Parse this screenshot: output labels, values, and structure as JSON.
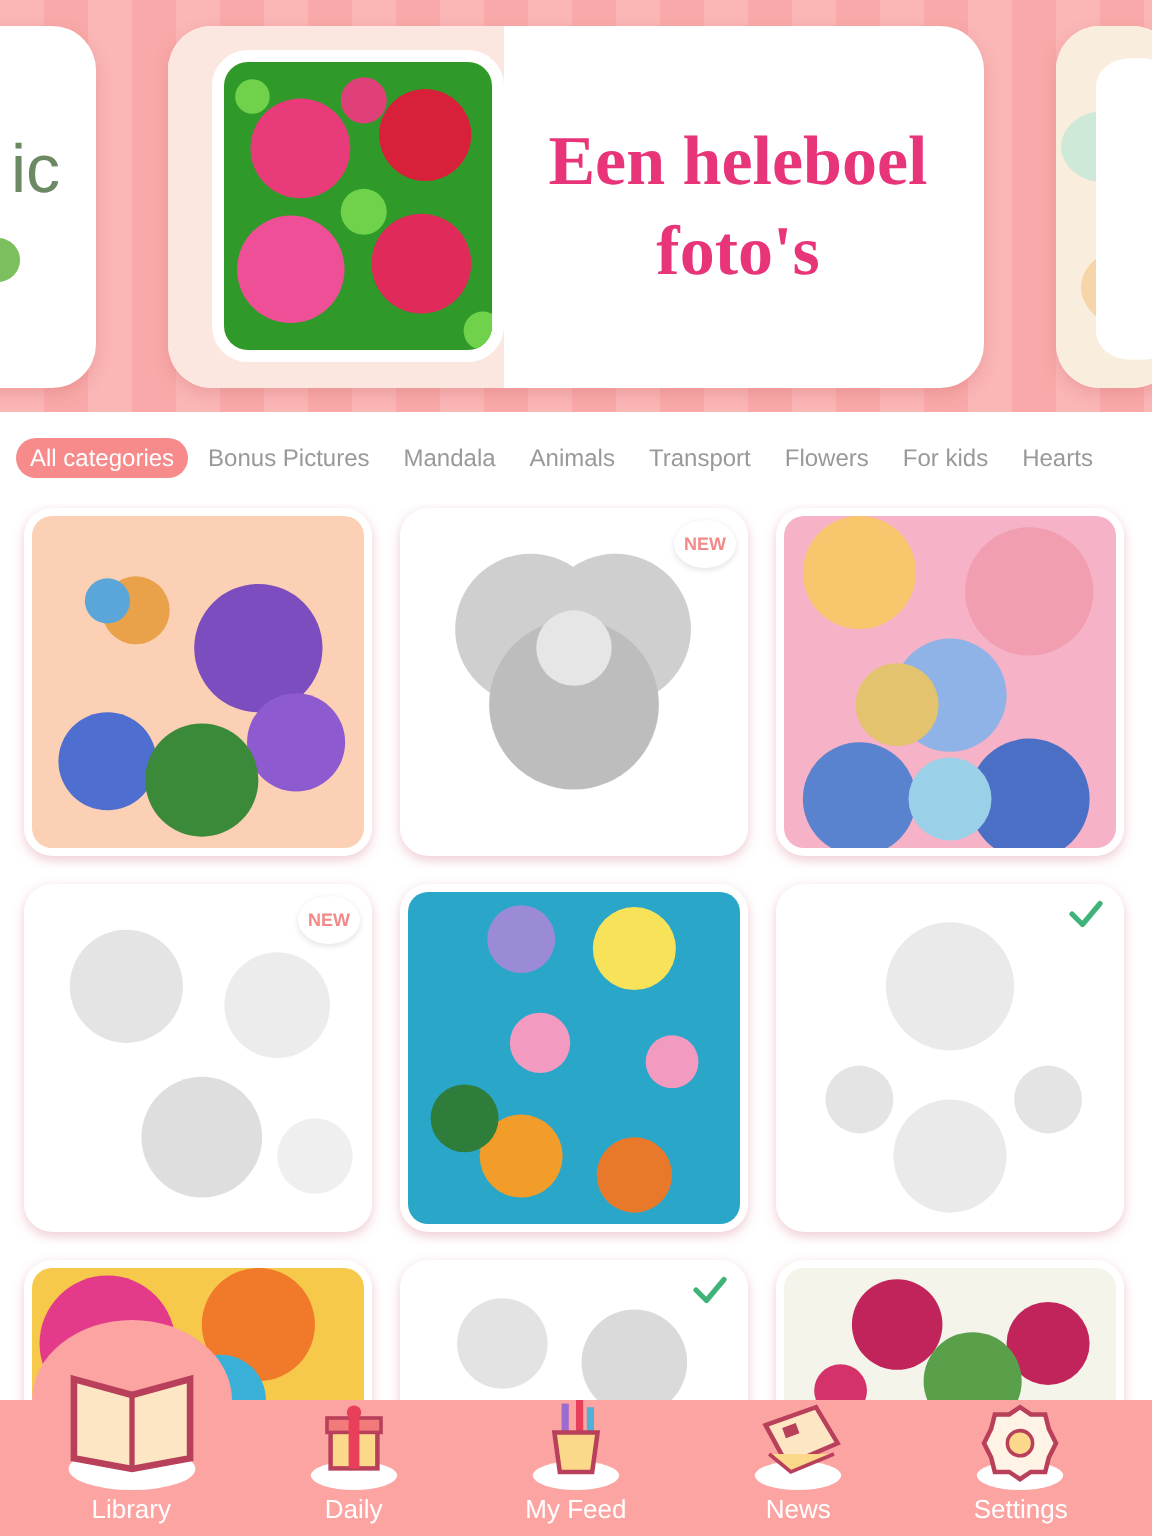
{
  "banner": {
    "left_card": {
      "text": "ic"
    },
    "main_card": {
      "title": "Een heleboel foto's",
      "image": {
        "kind": "picture"
      }
    },
    "right_card": {
      "kind": "picture"
    }
  },
  "categories": [
    {
      "label": "All categories",
      "selected": true
    },
    {
      "label": "Bonus Pictures",
      "selected": false
    },
    {
      "label": "Mandala",
      "selected": false
    },
    {
      "label": "Animals",
      "selected": false
    },
    {
      "label": "Transport",
      "selected": false
    },
    {
      "label": "Flowers",
      "selected": false
    },
    {
      "label": "For kids",
      "selected": false
    },
    {
      "label": "Hearts",
      "selected": false
    }
  ],
  "tiles": [
    {
      "kind": "picture",
      "completed": false
    },
    {
      "kind": "picture",
      "badge": "NEW",
      "completed": false
    },
    {
      "kind": "picture",
      "completed": false
    },
    {
      "kind": "picture",
      "badge": "NEW",
      "completed": false
    },
    {
      "kind": "picture",
      "completed": false
    },
    {
      "kind": "picture",
      "completed": true
    },
    {
      "kind": "picture",
      "completed": false
    },
    {
      "kind": "picture",
      "completed": true
    },
    {
      "kind": "picture",
      "completed": false
    }
  ],
  "tab_bar": [
    {
      "label": "Library",
      "selected": true
    },
    {
      "label": "Daily",
      "selected": false
    },
    {
      "label": "My Feed",
      "selected": false
    },
    {
      "label": "News",
      "selected": false
    },
    {
      "label": "Settings",
      "selected": false
    }
  ]
}
